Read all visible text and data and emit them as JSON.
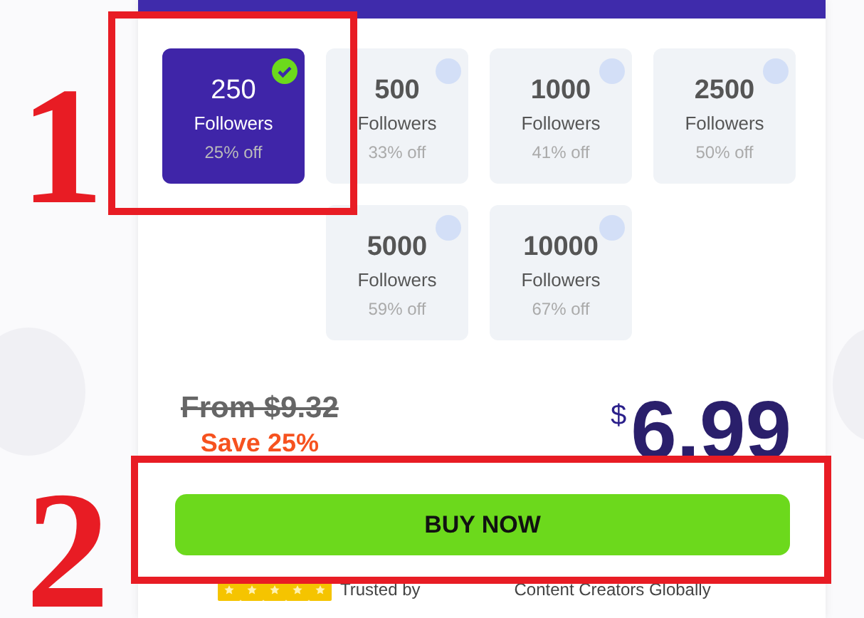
{
  "packages": [
    {
      "amount": "250",
      "unit": "Followers",
      "discount": "25% off",
      "selected": true
    },
    {
      "amount": "500",
      "unit": "Followers",
      "discount": "33% off",
      "selected": false
    },
    {
      "amount": "1000",
      "unit": "Followers",
      "discount": "41% off",
      "selected": false
    },
    {
      "amount": "2500",
      "unit": "Followers",
      "discount": "50% off",
      "selected": false
    },
    {
      "amount": "5000",
      "unit": "Followers",
      "discount": "59% off",
      "selected": false
    },
    {
      "amount": "10000",
      "unit": "Followers",
      "discount": "67% off",
      "selected": false
    }
  ],
  "price": {
    "original": "From $9.32",
    "savings": "Save 25%",
    "currency": "$",
    "amount": "6.99"
  },
  "buy_button": "BUY NOW",
  "trust": {
    "stars": 5,
    "prefix": "Trusted by",
    "suffix": "Content Creators Globally"
  },
  "annotations": [
    {
      "label": "1"
    },
    {
      "label": "2"
    }
  ]
}
